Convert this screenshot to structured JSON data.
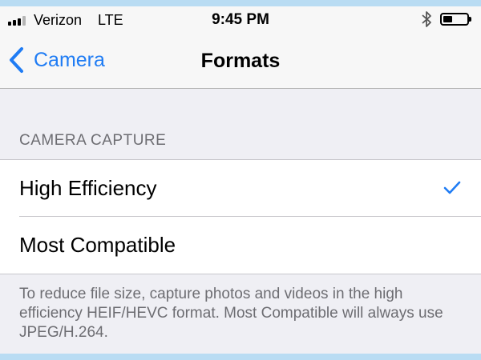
{
  "status_bar": {
    "carrier": "Verizon",
    "network": "LTE",
    "time": "9:45 PM",
    "signal_bars_filled": 3,
    "signal_bars_total": 4,
    "bluetooth_icon": "bluetooth-icon",
    "battery_level": 0.35
  },
  "nav": {
    "back_label": "Camera",
    "back_icon": "chevron-left-icon",
    "title": "Formats",
    "accent_color": "#1f7cf4"
  },
  "section": {
    "header": "CAMERA CAPTURE",
    "options": [
      {
        "label": "High Efficiency",
        "selected": true
      },
      {
        "label": "Most Compatible",
        "selected": false
      }
    ],
    "footer": "To reduce file size, capture photos and videos in the high efficiency HEIF/HEVC format. Most Compatible will always use JPEG/H.264."
  }
}
